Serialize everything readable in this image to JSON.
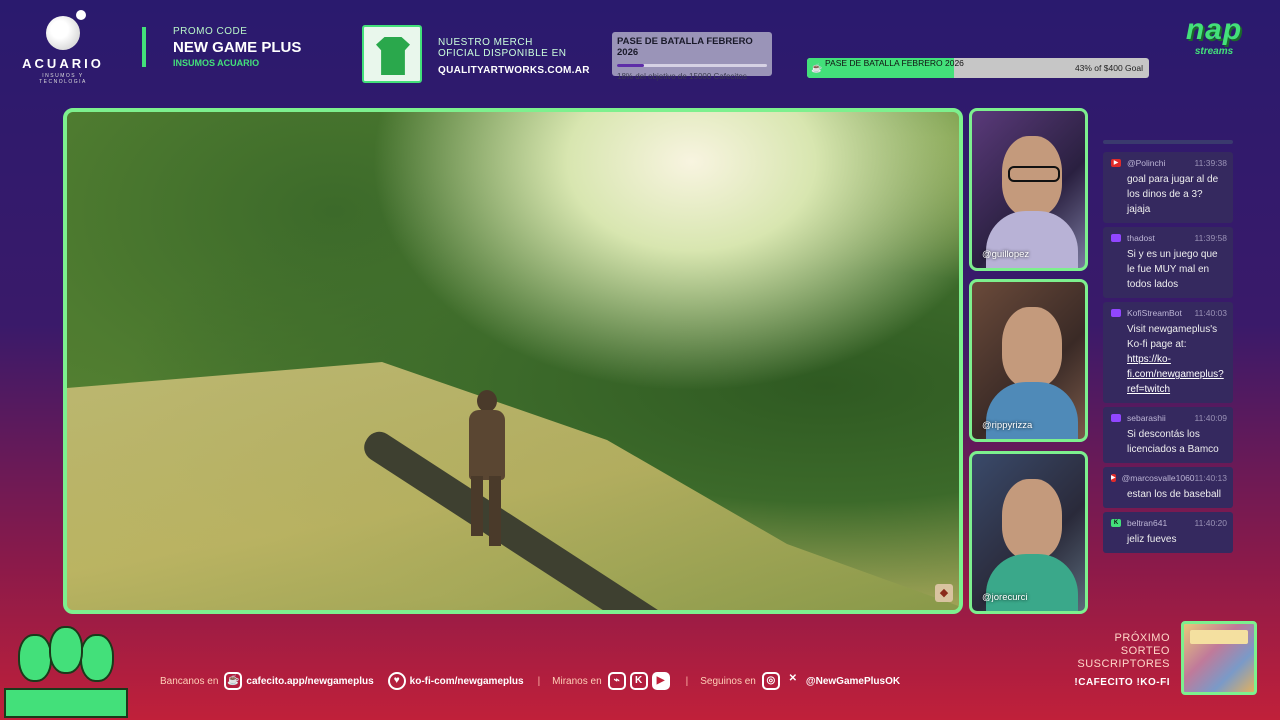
{
  "header": {
    "acuario": {
      "name": "ACUARIO",
      "tagline": "INSUMOS Y TECNOLOGIA"
    },
    "promo": {
      "label": "PROMO CODE",
      "code": "NEW GAME PLUS",
      "sponsor": "INSUMOS ACUARIO"
    },
    "merch": {
      "line1": "NUESTRO MERCH",
      "line2": "OFICIAL DISPONIBLE EN",
      "url": "QUALITYARTWORKS.COM.AR"
    },
    "battle_pass": {
      "title": "PASE DE BATALLA FEBRERO 2026",
      "subtitle": "18% del objetivo de 15000 Cafecitos",
      "progress": 0.18
    },
    "goal": {
      "label": "PASE DE BATALLA FEBRERO 2026",
      "status": "43% of $400 Goal",
      "progress": 0.43
    },
    "nap_logo": {
      "big": "nap",
      "small": "streams"
    }
  },
  "cams": [
    {
      "handle": "@guillopez"
    },
    {
      "handle": "@rippyrizza"
    },
    {
      "handle": "@jorecurci"
    }
  ],
  "chat": {
    "messages": [
      {
        "platform": "youtube",
        "user": "@Polinchi",
        "time": "11:39:38",
        "text": "goal para jugar al de los dinos de a 3? jajaja"
      },
      {
        "platform": "twitch",
        "user": "thadost",
        "time": "11:39:58",
        "text": "Si y es un juego que le fue MUY mal en todos lados"
      },
      {
        "platform": "twitch",
        "user": "KofiStreamBot",
        "time": "11:40:03",
        "text": "Visit newgameplus's Ko-fi page at: ",
        "link": "https://ko-fi.com/newgameplus?ref=twitch"
      },
      {
        "platform": "twitch",
        "user": "sebarashii",
        "time": "11:40:09",
        "text": "Si descontás los licenciados a Bamco"
      },
      {
        "platform": "youtube",
        "user": "@marcosvalle1060",
        "time": "11:40:13",
        "text": "estan los de baseball"
      },
      {
        "platform": "kick",
        "user": "beltran641",
        "time": "11:40:20",
        "text": "jeliz fueves"
      }
    ]
  },
  "footer": {
    "donate_label": "Bancanos en",
    "cafecito": "cafecito.app/newgameplus",
    "kofi": "ko-fi-com/newgameplus",
    "watch_label": "Miranos en",
    "follow_label": "Seguinos en",
    "social_handle": "@NewGamePlusOK",
    "separator": "|",
    "sorteo_line1": "PRÓXIMO",
    "sorteo_line2": "SORTEO",
    "sorteo_line3": "SUSCRIPTORES",
    "sorteo_cmd": "!CAFECITO  !KO-FI"
  },
  "colors": {
    "accent": "#43e07a",
    "frame": "#7df08e",
    "chat_bg": "#35295f"
  }
}
